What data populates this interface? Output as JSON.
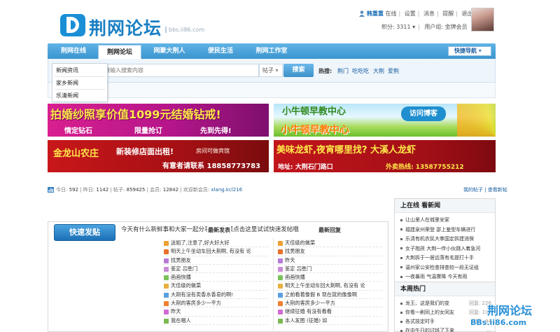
{
  "header": {
    "logo_text": "荆网论坛",
    "logo_sub": "bbs.ii86.com",
    "username": "韩重重",
    "online_status": "在线",
    "links": [
      "设置",
      "消息",
      "提醒",
      "退出"
    ],
    "points": "积分: 3311",
    "group": "用户组: 金牌会员"
  },
  "nav": {
    "items": [
      "荆网在线",
      "荆网论坛",
      "网聚大荆人",
      "便民生活",
      "荆网工作室"
    ],
    "quick_nav": "快捷导航"
  },
  "search": {
    "placeholder": "请输入搜索内容",
    "type": "帖子",
    "button": "搜索",
    "hot_label": "热搜:",
    "hot_words": [
      "荆门",
      "吃吃吃",
      "大荆",
      "爱荆"
    ]
  },
  "dropdown": {
    "items": [
      "新闻资讯",
      "家乡新闻",
      "乐清新闻"
    ]
  },
  "banners": {
    "b1_title": "拍婚纱照享价值1099元结婚钻戒!",
    "b1_tags": [
      "情定钻石",
      "限量抢订",
      "先到先得!"
    ],
    "b2_title": "小牛顿早教中心",
    "b2_sub": "小牛顿早教中心",
    "b2_button": "访问博客",
    "b3_title": "金龙山农庄",
    "b3_sub": "新装修店面出租!",
    "b3_note": "房间可做宾馆",
    "b3_phone": "有意者请联系 18858773783",
    "b4_title": "美味龙虾,夜宵哪里找? 大溪人龙虾",
    "b4_addr": "地址: 大荆石门路口",
    "b4_phone": "外卖热线: 13587755212"
  },
  "stats": {
    "today_label": "今日:",
    "today": "592",
    "yesterday_label": "昨日:",
    "yesterday": "1142",
    "posts_label": "帖子:",
    "posts": "859425",
    "members_label": "会员:",
    "members": "12842",
    "welcome_label": "欢迎新会员:",
    "new_member": "xlang.kcl216",
    "my_posts": "我的帖子",
    "new_posts": "查看新帖"
  },
  "main": {
    "post_button": "快速发贴",
    "prompt": "今天有什么新鲜事和大家一起分享吗? 赶紧点击这里试试快速发帖哦",
    "tab_new": "最新发表",
    "tab_reply": "最新回复",
    "left_posts": [
      "送姐了,注意了,好大好大好",
      "明天上午坐动车回大荆啊, 有没有 论",
      "找男朋友",
      "鉴定 吕胜门",
      "画画快播",
      "天佳级的做菜",
      "大荆有没有卖香水香皂的啊!",
      "大荆的客房多少一平方",
      "昨天",
      "我在唱人"
    ],
    "right_posts": [
      "天佳级的做菜",
      "找男朋友",
      "昨天",
      "鉴定 吕胜门",
      "画画快播",
      "明天上午坐动车回大荆啊, 有没有 论",
      "之前看着像假 B 现在就的像像啊",
      "大荆的客房多少一平方",
      "继续征婚 有没有看看",
      "本人发图 (征婚) 如"
    ],
    "icon_colors": [
      "#f0a030",
      "#e8702a",
      "#b87ad8",
      "#c88ad6",
      "#7bc25a",
      "#e8b040",
      "#5aa0e0",
      "#f08030",
      "#d06ad0",
      "#7ab850"
    ]
  },
  "sidebar": {
    "section1_title": "上在线 看新闻",
    "news": [
      "让山里人在城里安家",
      "福建泉州荣登 邵上鉴型车辆进行",
      "乐清有机农民大拳国定拆建消保",
      "女子抱孩 大荆一伴小伙跳入着急河",
      "大荆拆于一居远落有毛提打十手",
      "温州家公安检查排查较一段无证组",
      "一夜暴雨 气温骤降 今天有雨"
    ],
    "section2_title": "本周热门",
    "hot": [
      {
        "title": "龙王、这是我们的变",
        "meta": "回复: 226"
      },
      {
        "title": "你看一刷同上的女同友",
        "meta": "回复: 107"
      },
      {
        "title": "各式技定时手",
        "meta": "回复: 94"
      },
      {
        "title": "在中午日的讨钱了下来",
        "meta": "..."
      }
    ]
  },
  "watermark": {
    "line1": "荆网论坛",
    "line2": "BBs.ii86.com"
  }
}
